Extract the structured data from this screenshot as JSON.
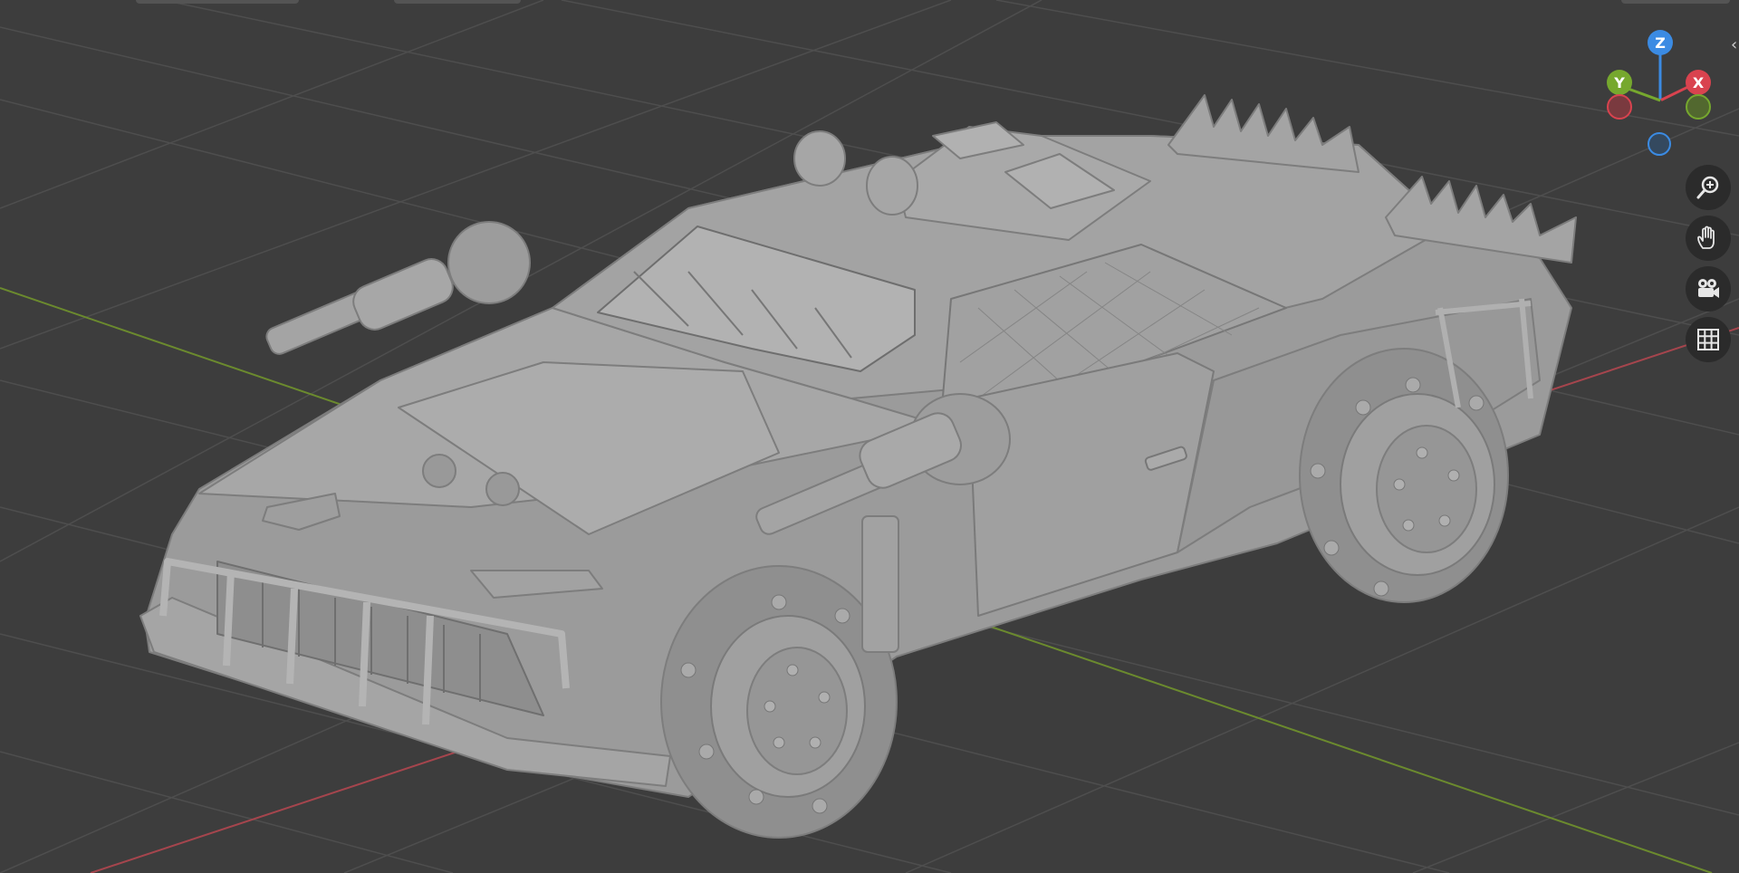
{
  "viewport": {
    "background": "#3d3d3d",
    "grid_color": "#4e4e4e",
    "x_axis_color": "#a5454d",
    "y_axis_color": "#6b8a2e",
    "model_color": "#9a9a9a"
  },
  "gizmo": {
    "z_label": "Z",
    "y_label": "Y",
    "x_label": "X",
    "colors": {
      "x": "#d9434f",
      "y": "#76a82e",
      "z": "#3b8be3"
    }
  },
  "controls": {
    "zoom": {
      "icon": "zoom-in-icon"
    },
    "pan": {
      "icon": "hand-icon"
    },
    "camera": {
      "icon": "camera-icon"
    },
    "ortho": {
      "icon": "grid-icon"
    }
  },
  "edge_handle": "‹"
}
